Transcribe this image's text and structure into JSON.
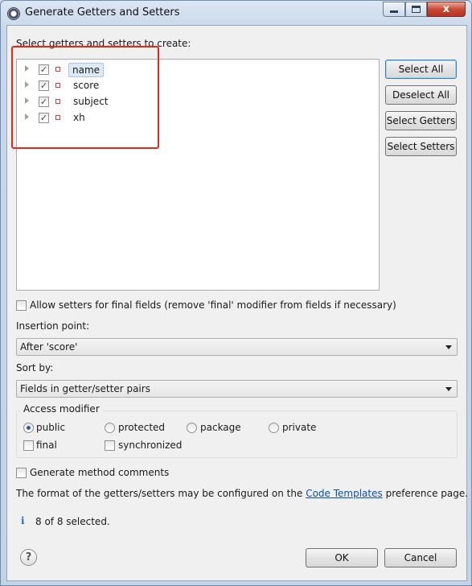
{
  "window": {
    "title": "Generate Getters and Setters",
    "close_glyph": "x"
  },
  "prompt_label": "Select getters and setters to create:",
  "fields": [
    {
      "name": "name",
      "checked": true,
      "selected": true
    },
    {
      "name": "score",
      "checked": true,
      "selected": false
    },
    {
      "name": "subject",
      "checked": true,
      "selected": false
    },
    {
      "name": "xh",
      "checked": true,
      "selected": false
    }
  ],
  "side_buttons": {
    "select_all": "Select All",
    "deselect_all": "Deselect All",
    "select_getters": "Select Getters",
    "select_setters": "Select Setters"
  },
  "allow_setters_final": {
    "label": "Allow setters for final fields (remove 'final' modifier from fields if necessary)",
    "checked": false
  },
  "insertion_point": {
    "label": "Insertion point:",
    "value": "After 'score'"
  },
  "sort_by": {
    "label": "Sort by:",
    "value": "Fields in getter/setter pairs"
  },
  "access_modifier": {
    "title": "Access modifier",
    "options": [
      {
        "label": "public",
        "checked": true
      },
      {
        "label": "protected",
        "checked": false
      },
      {
        "label": "package",
        "checked": false
      },
      {
        "label": "private",
        "checked": false
      }
    ],
    "final_label": "final",
    "synchronized_label": "synchronized"
  },
  "generate_comments": {
    "label": "Generate method comments",
    "checked": false
  },
  "format_note": {
    "before": "The format of the getters/setters may be configured on the",
    "link": "Code Templates",
    "after": "preference page."
  },
  "status": {
    "icon": "info-icon",
    "text": "8 of 8 selected."
  },
  "footer": {
    "help": "?",
    "ok": "OK",
    "cancel": "Cancel"
  },
  "colors": {
    "highlight_box": "#e8271c",
    "link": "#0b4fb5",
    "field_icon": "#d23a3a"
  }
}
